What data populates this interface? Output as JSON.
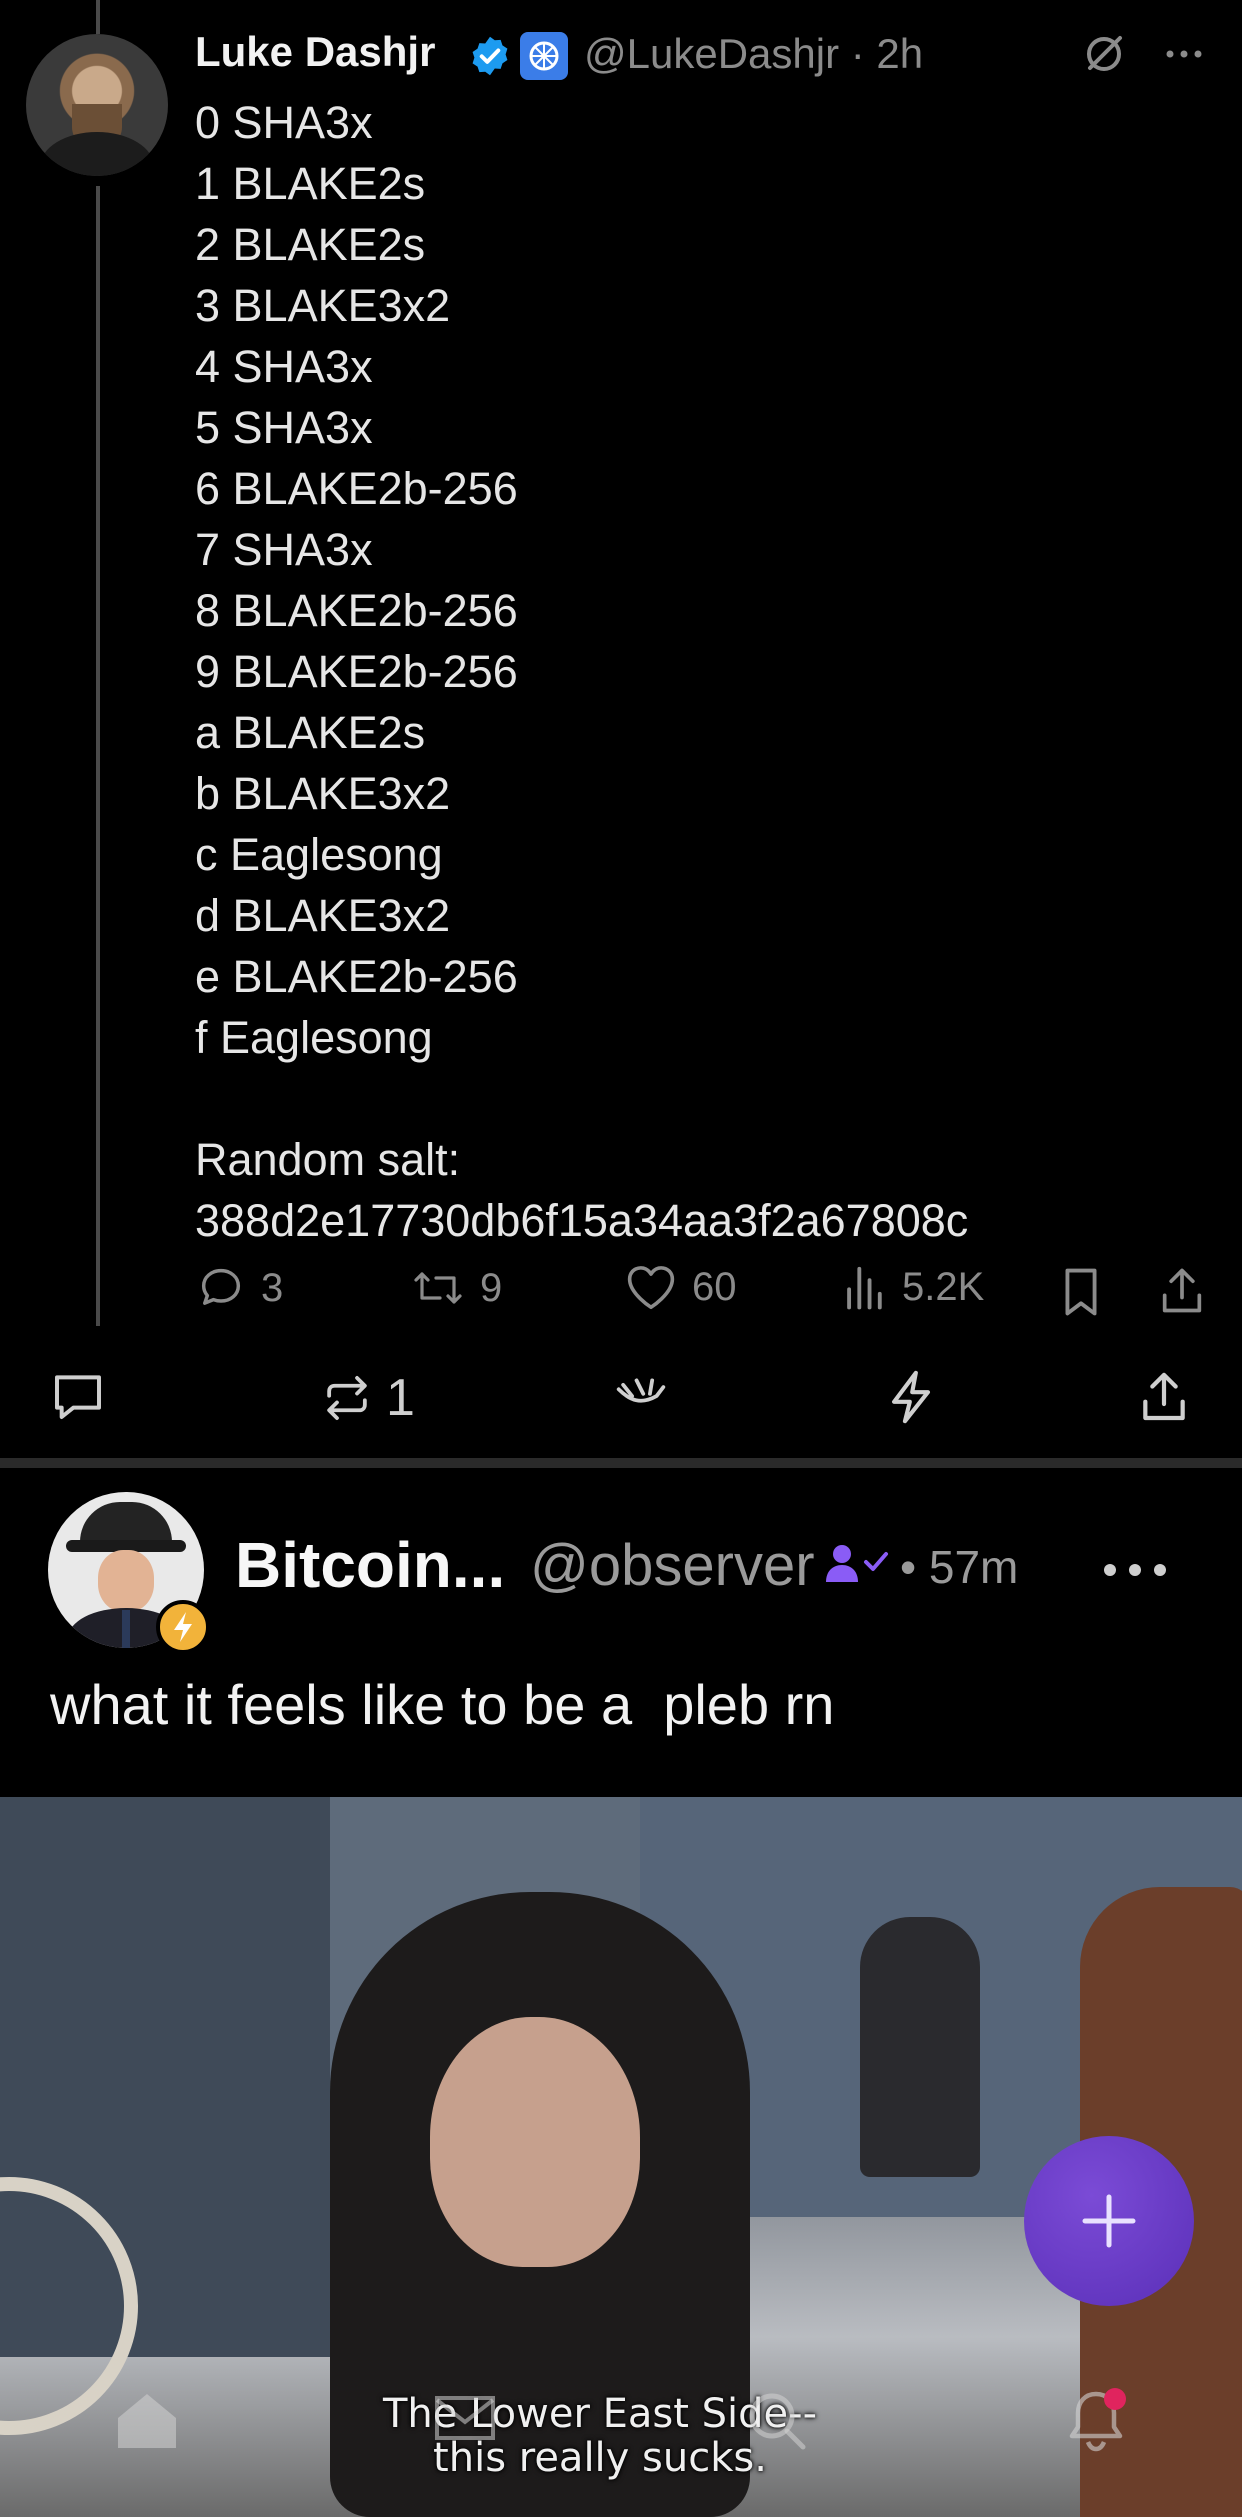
{
  "post1": {
    "author_name": "Luke Dashjr",
    "handle": "@LukeDashjr",
    "time": "2h",
    "lines": [
      "0 SHA3x",
      "1 BLAKE2s",
      "2 BLAKE2s",
      "3 BLAKE3x2",
      "4 SHA3x",
      "5 SHA3x",
      "6 BLAKE2b-256",
      "7 SHA3x",
      "8 BLAKE2b-256",
      "9 BLAKE2b-256",
      "a BLAKE2s",
      "b BLAKE3x2",
      "c Eaglesong",
      "d BLAKE3x2",
      "e BLAKE2b-256",
      "f Eaglesong"
    ],
    "salt_label": "Random salt:",
    "salt_value": "388d2e17730db6f15a34aa3f2a67808c",
    "actions": {
      "replies": "3",
      "reposts": "9",
      "likes": "60",
      "views": "5.2K"
    }
  },
  "quote_bar": {
    "reposts": "1"
  },
  "post2": {
    "author_name": "Bitcoin...",
    "handle": "@observer",
    "time": "57m",
    "text": "what it feels like to be a  pleb rn",
    "media_caption_line1": "The Lower East Side--",
    "media_caption_line2": "this really sucks."
  },
  "colors": {
    "background": "#000000",
    "text_primary": "#e7e9ea",
    "text_secondary": "#8b8b8b",
    "verified_blue": "#1d9bf0",
    "fab_purple": "#6a3bc8",
    "notification_dot": "#e0245e"
  },
  "icons": {
    "reply": "speech-bubble-icon",
    "repost": "repost-arrows-icon",
    "like": "heart-icon",
    "views": "bar-chart-icon",
    "bookmark": "bookmark-icon",
    "share": "share-upload-icon",
    "zap": "lightning-icon",
    "react": "hand-icon",
    "home": "home-icon",
    "messages": "envelope-icon",
    "search": "search-icon",
    "notifications": "bell-icon",
    "compose": "plus-icon"
  }
}
